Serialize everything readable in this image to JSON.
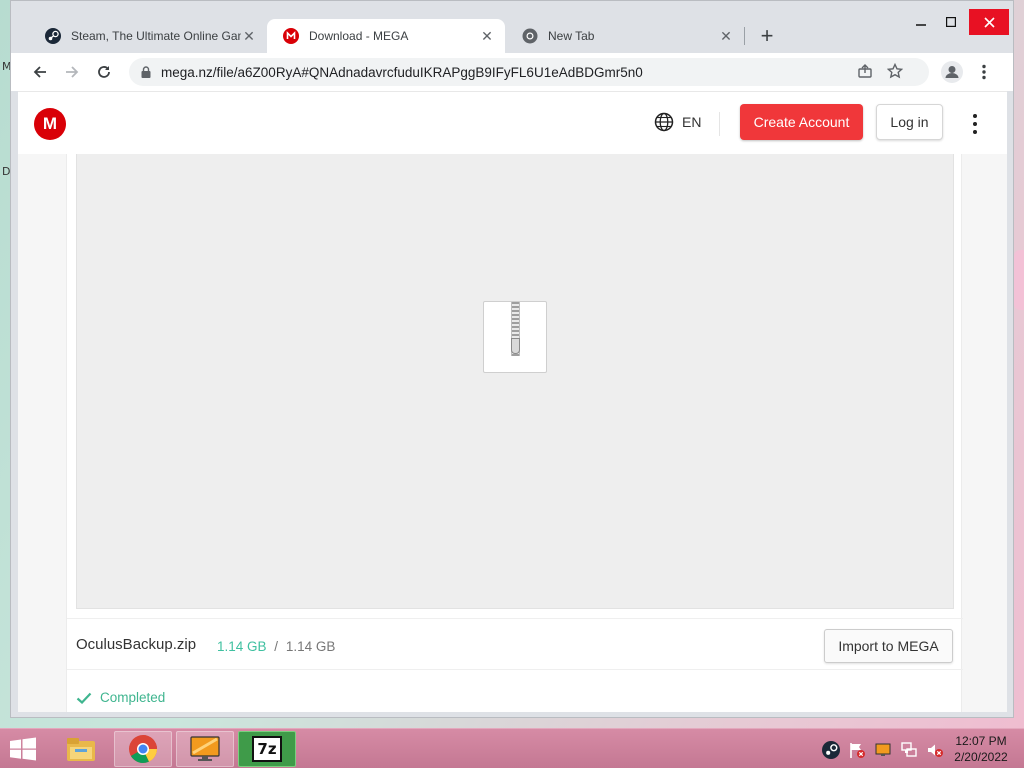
{
  "browser": {
    "tabs": [
      {
        "title": "Steam, The Ultimate Online Game Platform"
      },
      {
        "title": "Download - MEGA"
      },
      {
        "title": "New Tab"
      }
    ],
    "url": "mega.nz/file/a6Z00RyA#QNAdnadavrcfuduIKRAPggB9IFyFL6U1eAdBDGmr5n0"
  },
  "mega": {
    "logo_letter": "M",
    "language": "EN",
    "create_account_label": "Create Account",
    "login_label": "Log in"
  },
  "file": {
    "name": "OculusBackup.zip",
    "downloaded": "1.14 GB",
    "separator": "/",
    "total": "1.14 GB",
    "import_label": "Import to MEGA",
    "status": "Completed"
  },
  "desktop": {
    "fragment_1": "M",
    "fragment_2": "D"
  },
  "taskbar": {
    "time": "12:07 PM",
    "date": "2/20/2022",
    "sevenzip_label": "7z"
  },
  "colors": {
    "mega_red": "#d90007",
    "create_button": "#f0373a",
    "progress_green": "#3fc0a0"
  }
}
